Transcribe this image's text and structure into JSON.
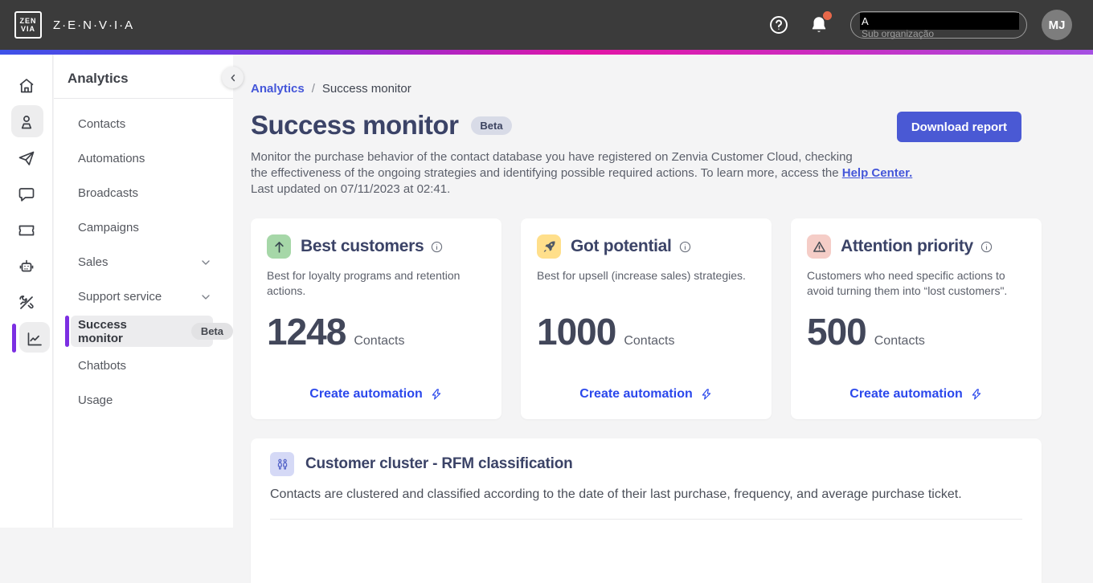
{
  "header": {
    "brand": "Z·E·N·V·I·A",
    "logo_top": "ZEN",
    "logo_bottom": "VIA",
    "org_selector": {
      "value_visible": "A",
      "sub_label": "Sub organização"
    },
    "avatar_initials": "MJ"
  },
  "rail": {
    "items": [
      "home",
      "contacts",
      "broadcast",
      "conversations",
      "tickets",
      "chatbot",
      "tools",
      "analytics"
    ],
    "active_item": "analytics"
  },
  "sidebar": {
    "title": "Analytics",
    "items": [
      {
        "label": "Contacts"
      },
      {
        "label": "Automations"
      },
      {
        "label": "Broadcasts"
      },
      {
        "label": "Campaigns"
      },
      {
        "label": "Sales",
        "expandable": true
      },
      {
        "label": "Support service",
        "expandable": true
      },
      {
        "label": "Success monitor",
        "badge": "Beta",
        "active": true
      },
      {
        "label": "Chatbots"
      },
      {
        "label": "Usage"
      }
    ]
  },
  "breadcrumb": {
    "parent": "Analytics",
    "separator": "/",
    "current": "Success monitor"
  },
  "page": {
    "title": "Success monitor",
    "badge": "Beta",
    "desc_line1": "Monitor the purchase behavior of the contact database you have registered on Zenvia Customer Cloud, checking",
    "desc_line2": "the effectiveness of the ongoing strategies and identifying possible required actions. To learn more, access the ",
    "help_link": "Help Center.",
    "desc_line3": "Last updated on 07/11/2023 at 02:41.",
    "download_label": "Download report"
  },
  "cards": [
    {
      "icon": "arrow-up-icon",
      "icon_bg": "#a6d7a8",
      "title": "Best customers",
      "description": "Best for loyalty programs and retention actions.",
      "value": "1248",
      "unit": "Contacts",
      "action_label": "Create automation"
    },
    {
      "icon": "rocket-icon",
      "icon_bg": "#ffdf8b",
      "title": "Got potential",
      "description": "Best for upsell (increase sales) strategies.",
      "value": "1000",
      "unit": "Contacts",
      "action_label": "Create automation"
    },
    {
      "icon": "warning-icon",
      "icon_bg": "#f5cdc7",
      "title": "Attention priority",
      "description": "Customers who need specific actions to avoid turning them into “lost customers\".",
      "value": "500",
      "unit": "Contacts",
      "action_label": "Create automation"
    }
  ],
  "cluster": {
    "title": "Customer cluster - RFM classification",
    "description": "Contacts are clustered and classified according to the date of their last purchase, frequency, and average purchase ticket."
  },
  "colors": {
    "header_bg": "#3b3b3b",
    "gradient": [
      "#3d52e8",
      "#8133dc",
      "#e216a6",
      "#a550e2"
    ],
    "accent_purple": "#7c2fe2",
    "button_indigo": "#4a59d4",
    "link_blue": "#2b48ec",
    "breadcrumb_link": "#4456d9",
    "title_navy": "#3b4367",
    "notification_dot": "#e8684a"
  }
}
